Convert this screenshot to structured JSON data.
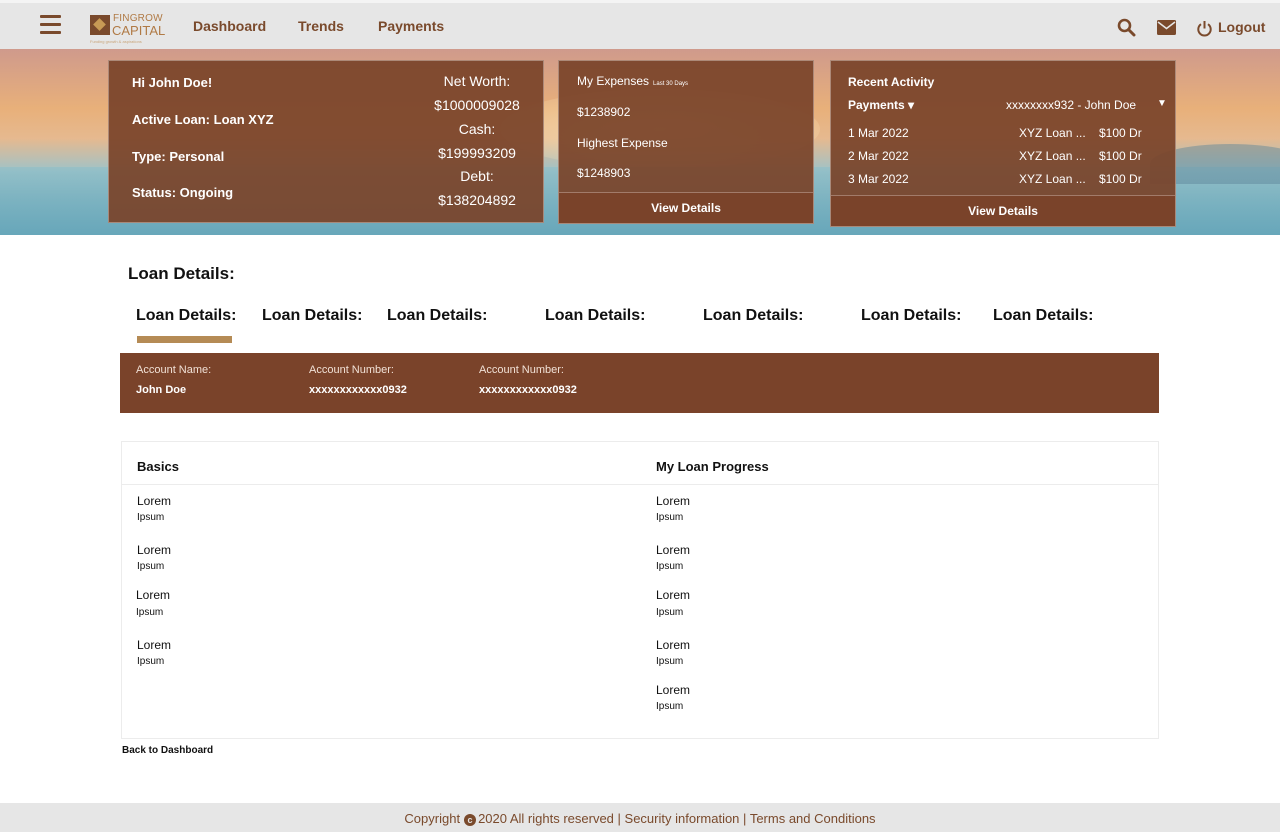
{
  "nav": {
    "brand_top": "FINGROW",
    "brand_bottom": "CAPITAL",
    "brand_tagline": "Funding growth & aspirations",
    "links": [
      "Dashboard",
      "Trends",
      "Payments"
    ],
    "logout_label": "Logout"
  },
  "summary": {
    "greeting": "Hi John Doe!",
    "active_loan": "Active Loan: Loan XYZ",
    "type": "Type: Personal",
    "status": "Status: Ongoing",
    "net_worth_label": "Net Worth:",
    "net_worth_value": "$1000009028",
    "cash_label": "Cash:",
    "cash_value": "$199993209",
    "debt_label": "Debt:",
    "debt_value": "$138204892"
  },
  "expenses": {
    "title": "My Expenses",
    "period": "Last 30 Days",
    "total": "$1238902",
    "highest_label": "Highest Expense",
    "highest_value": "$1248903",
    "footer": "View Details"
  },
  "activity": {
    "title": "Recent Activity",
    "filter": "Payments ▾",
    "account": "xxxxxxxx932 - John Doe",
    "rows": [
      {
        "date": "1 Mar 2022",
        "desc": "XYZ Loan ...",
        "amount": "$100 Dr"
      },
      {
        "date": "2 Mar 2022",
        "desc": "XYZ Loan ...",
        "amount": "$100 Dr"
      },
      {
        "date": "3 Mar 2022",
        "desc": "XYZ Loan ...",
        "amount": "$100 Dr"
      }
    ],
    "footer": "View Details"
  },
  "page_title": "Loan Details:",
  "tabs": [
    "Loan Details:",
    "Loan Details:",
    "Loan Details:",
    "Loan Details:",
    "Loan Details:",
    "Loan Details:",
    "Loan Details:"
  ],
  "account": {
    "name_label": "Account Name:",
    "name_value": "John Doe",
    "number_label": "Account Number:",
    "number_value": "xxxxxxxxxxxx0932",
    "number2_label": "Account Number:",
    "number2_value": "xxxxxxxxxxxx0932"
  },
  "basics": {
    "title": "Basics",
    "items": [
      {
        "label": "Lorem",
        "value": "Ipsum"
      },
      {
        "label": "Lorem",
        "value": "Ipsum"
      },
      {
        "label": "Lorem",
        "value": "Ipsum"
      },
      {
        "label": "Lorem",
        "value": "Ipsum"
      }
    ]
  },
  "progress": {
    "title": "My Loan Progress",
    "items": [
      {
        "label": "Lorem",
        "value": "Ipsum"
      },
      {
        "label": "Lorem",
        "value": "Ipsum"
      },
      {
        "label": "Lorem",
        "value": "Ipsum"
      },
      {
        "label": "Lorem",
        "value": "Ipsum"
      },
      {
        "label": "Lorem",
        "value": "Ipsum"
      }
    ]
  },
  "back_link": "Back to Dashboard",
  "footer": {
    "copyright_prefix": "Copyright",
    "copyright_suffix": "2020 All rights reserved |",
    "security": "Security information",
    "separator": "|",
    "terms": "Terms and Conditions"
  },
  "colors": {
    "brand_brown": "#7a432a",
    "accent_gold": "#b58b55",
    "nav_bg": "#e6e6e6"
  },
  "icons": [
    "menu-icon",
    "search-icon",
    "mail-icon",
    "power-icon",
    "copyright-icon",
    "dropdown-caret-icon"
  ]
}
